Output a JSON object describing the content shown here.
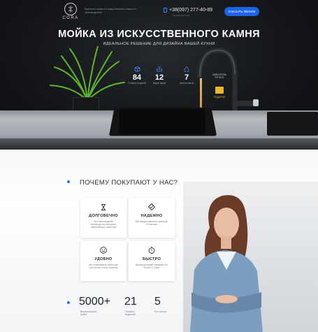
{
  "header": {
    "logo_text": "CORA",
    "tagline": "Кухонные мойки из искусственного камня от производителя",
    "phone": "+38(097) 277-40-89",
    "phone_sub": "Перезвоните мне",
    "cta_label": "ЗАКАЗАТЬ ЗВОНОК"
  },
  "hero": {
    "title": "МОЙКА ИЗ ИСКУССТВЕННОГО КАМНЯ",
    "subtitle": "ИДЕАЛЬНОЕ РЕШЕНИЕ ДЛЯ ДИЗАЙНА ВАШЕЙ КУХНИ",
    "stats": [
      {
        "value": "84",
        "caption": "Готовых моделей",
        "icon": "box-icon"
      },
      {
        "value": "12",
        "caption": "Видов форм",
        "icon": "sink-icon"
      },
      {
        "value": "7",
        "caption": "Цветов камня",
        "icon": "drop-icon"
      }
    ],
    "feature_label": "СМЕСИТЕЛЬ РОТАТО",
    "gift_caption": "ПОДАРОК!"
  },
  "why": {
    "title": "ПОЧЕМУ ПОКУПАЮТ У НАС?",
    "cards": [
      {
        "title": "ДОЛГОВЕЧНО",
        "text": "При производстве используется материал европейского качества",
        "icon": "hourglass-icon"
      },
      {
        "title": "НАДЕЖНО",
        "text": "Мы предоставляем гарантию 24 месяца",
        "icon": "diamond-check-icon"
      },
      {
        "title": "УДОБНО",
        "text": "Вы оплачиваете заказ при получении после осмотра",
        "icon": "smile-icon"
      },
      {
        "title": "БЫСТРО",
        "text": "Время доставки занимает не более 1-2 дня",
        "icon": "stopwatch-icon"
      }
    ],
    "numbers": [
      {
        "value": "5000+",
        "caption": "Выполненных работ"
      },
      {
        "value": "21",
        "caption": "Готовых моделей"
      },
      {
        "value": "5",
        "caption": "Лет опыта"
      }
    ]
  },
  "colors": {
    "accent": "#1d63e6",
    "gift": "#e8b82a",
    "dark": "#141619"
  }
}
